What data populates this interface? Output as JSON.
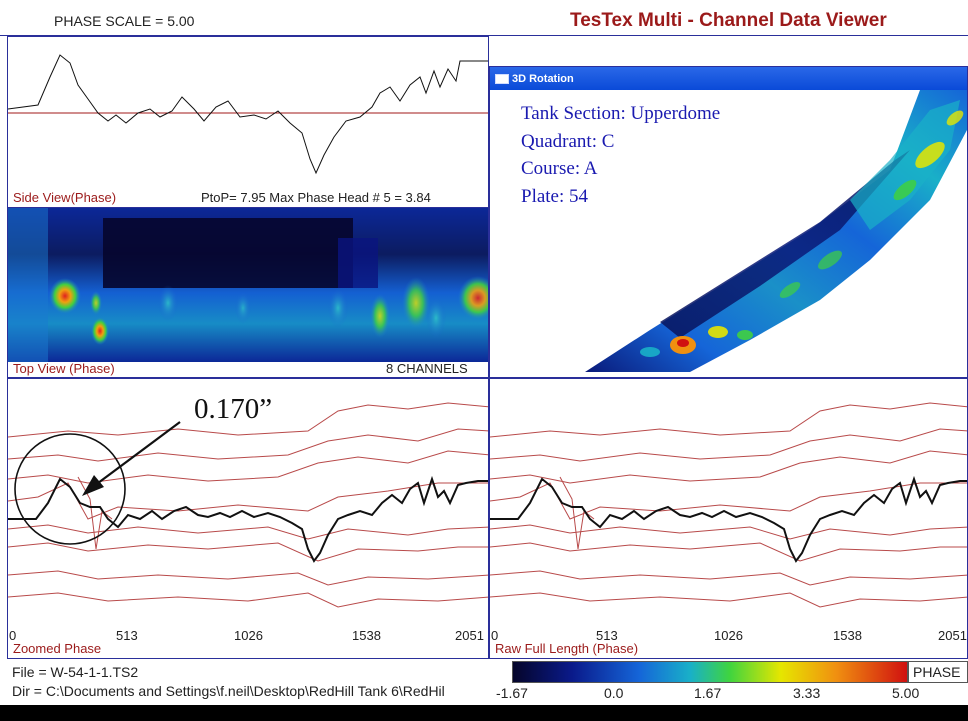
{
  "header": {
    "phase_scale": "PHASE SCALE =  5.00",
    "app_title": "TesTex  Multi - Channel  Data  Viewer"
  },
  "side_view": {
    "label": "Side View(Phase)",
    "stats": "PtoP= 7.95   Max Phase Head # 5 = 3.84"
  },
  "top_view": {
    "label": "Top View (Phase)",
    "channels": "8 CHANNELS"
  },
  "rotation_window": {
    "title": "3D Rotation",
    "tank_section": "Tank Section: Upperdome",
    "quadrant": "Quadrant: C",
    "course": "Course: A",
    "plate": "Plate: 54"
  },
  "zoomed": {
    "label": "Zoomed Phase",
    "annotation": "0.170”",
    "ticks": [
      "0",
      "513",
      "1026",
      "1538",
      "2051"
    ]
  },
  "raw": {
    "label": "Raw Full Length (Phase)",
    "ticks": [
      "0",
      "513",
      "1026",
      "1538",
      "2051"
    ]
  },
  "status": {
    "file": "File = W-54-1-1.TS2",
    "dir": "Dir = C:\\Documents and Settings\\f.neil\\Desktop\\RedHill Tank 6\\RedHil"
  },
  "colorbar": {
    "label": "PHASE",
    "ticks": [
      "-1.67",
      "0.0",
      "1.67",
      "3.33",
      "5.00"
    ],
    "colors": [
      "#05052a",
      "#0a1a8a",
      "#1565d8",
      "#19b0c8",
      "#3fd43f",
      "#e6e600",
      "#f09010",
      "#d01010"
    ]
  }
}
